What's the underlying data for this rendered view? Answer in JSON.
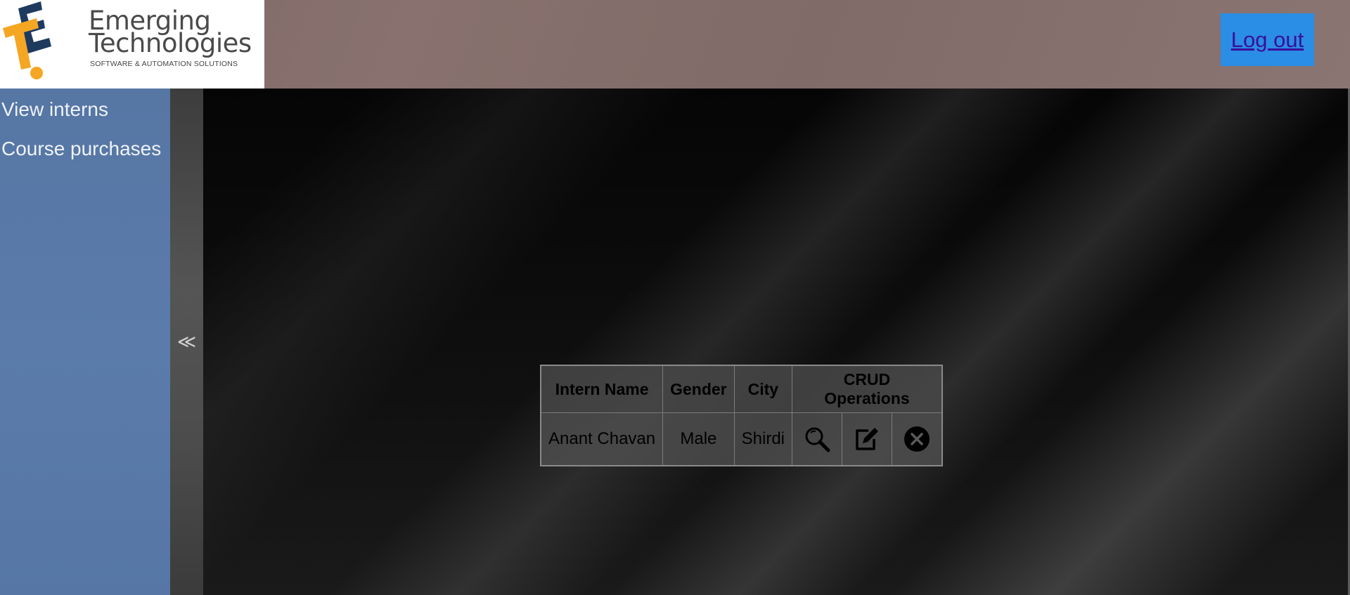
{
  "header": {
    "logo": {
      "line1": "Emerging",
      "line2": "Technologies",
      "tagline": "SOFTWARE & AUTOMATION SOLUTIONS"
    },
    "logout_label": "Log out"
  },
  "sidebar": {
    "items": [
      {
        "label": "View interns"
      },
      {
        "label": "Course purchases"
      }
    ],
    "collapse_icon": "double-chevron-left-icon",
    "collapse_glyph": "≪"
  },
  "table": {
    "headers": [
      "Intern Name",
      "Gender",
      "City",
      "CRUD Operations"
    ],
    "rows": [
      {
        "name": "Anant Chavan",
        "gender": "Male",
        "city": "Shirdi",
        "actions": [
          "search-icon",
          "edit-icon",
          "delete-icon"
        ]
      }
    ]
  },
  "colors": {
    "header_bg": "#826c69",
    "logout_bg": "#2a8de6",
    "sidebar_bg": "#5878a6",
    "logo_orange": "#f5a623",
    "logo_navy": "#1e3a5f"
  }
}
